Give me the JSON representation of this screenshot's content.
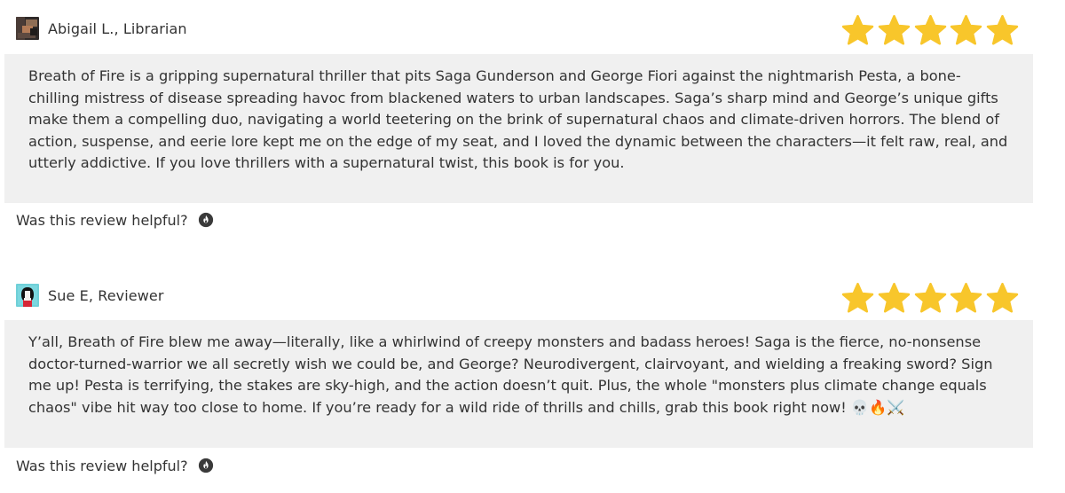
{
  "reviews": [
    {
      "reviewer": "Abigail L., Librarian",
      "rating": 5,
      "max_rating": 5,
      "text": "Breath of Fire is a gripping supernatural thriller that pits Saga Gunderson and George Fiori against the nightmarish Pesta, a bone-chilling mistress of disease spreading havoc from blackened waters to urban landscapes. Saga’s sharp mind and George’s unique gifts make them a compelling duo, navigating a world teetering on the brink of supernatural chaos and climate-driven horrors. The blend of action, suspense, and eerie lore kept me on the edge of my seat, and I loved the dynamic between the characters—it felt raw, real, and utterly addictive. If you love thrillers with a supernatural twist, this book is for you.",
      "helpful_prompt": "Was this review helpful?",
      "helpful_icon": "flame-icon"
    },
    {
      "reviewer": "Sue E, Reviewer",
      "rating": 5,
      "max_rating": 5,
      "text": "Y’all, Breath of Fire blew me away—literally, like a whirlwind of creepy monsters and badass heroes! Saga is the fierce, no-nonsense doctor-turned-warrior we all secretly wish we could be, and George? Neurodivergent, clairvoyant, and wielding a freaking sword? Sign me up! Pesta is terrifying, the stakes are sky-high, and the action doesn’t quit. Plus, the whole \"monsters plus climate change equals chaos\" vibe hit way too close to home. If you’re ready for a wild ride of thrills and chills, grab this book right now! 💀🔥⚔️",
      "helpful_prompt": "Was this review helpful?",
      "helpful_icon": "flame-icon"
    }
  ],
  "colors": {
    "star": "#f8c62b",
    "panel": "#f0f0f0",
    "text": "#333333"
  }
}
